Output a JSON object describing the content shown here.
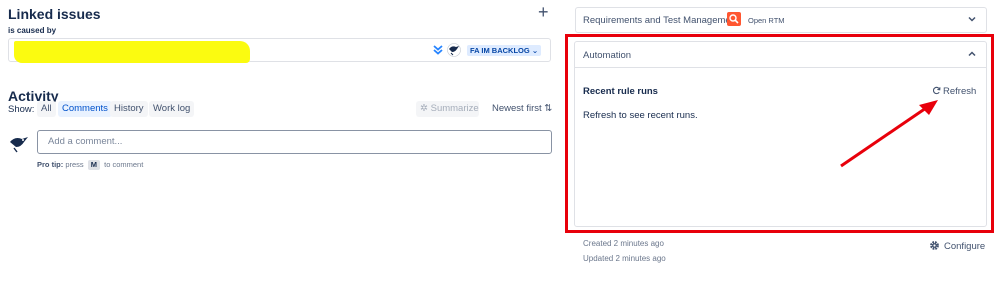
{
  "linked_issues": {
    "title": "Linked issues",
    "add_icon": "plus-icon",
    "relation": "is caused by",
    "item": {
      "priority_icon": "double-chevron-down-icon",
      "status": "FA IM BACKLOG"
    }
  },
  "activity": {
    "title": "Activity",
    "show_label": "Show:",
    "filters": [
      "All",
      "Comments",
      "History",
      "Work log"
    ],
    "active_filter": "Comments",
    "summarize": "Summarize",
    "sort": "Newest first",
    "comment_placeholder": "Add a comment...",
    "pro_tip": {
      "prefix": "Pro tip:",
      "press": "press",
      "key": "M",
      "suffix": "to comment"
    }
  },
  "rtm": {
    "title": "Requirements and Test Management",
    "open": "Open RTM"
  },
  "automation": {
    "title": "Automation",
    "recent_runs": "Recent rule runs",
    "refresh": "Refresh",
    "empty": "Refresh to see recent runs."
  },
  "footer": {
    "created": "Created 2 minutes ago",
    "updated": "Updated 2 minutes ago",
    "configure": "Configure"
  },
  "colors": {
    "highlight": "#e8000b",
    "link_blue": "#0052cc",
    "redaction": "#fbfb10",
    "rtm_icon": "#ff5630"
  }
}
